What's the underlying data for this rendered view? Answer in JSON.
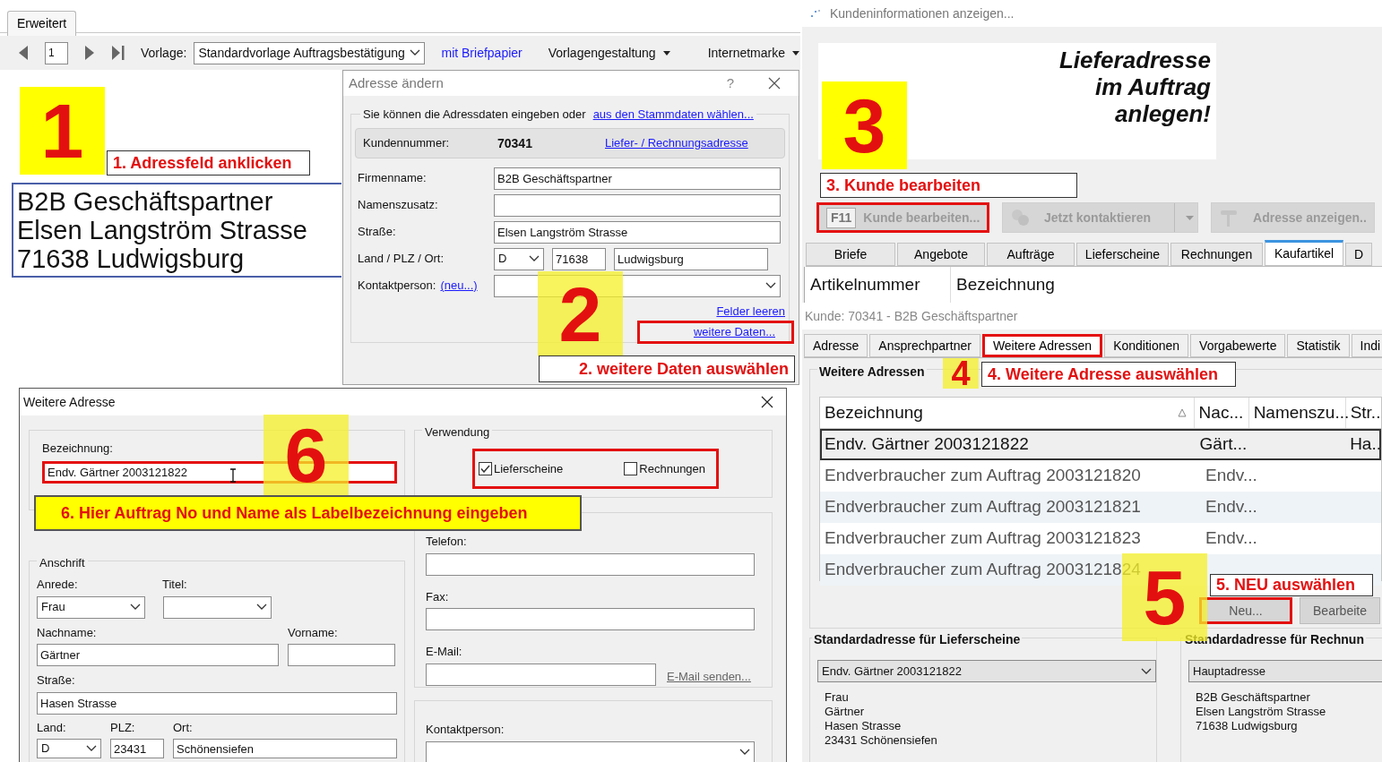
{
  "editor": {
    "tabs": [
      {
        "label": "Erweitert",
        "selected": true
      }
    ],
    "page": "1",
    "template_label": "Vorlage:",
    "template": "Standardvorlage Auftragsbestätigung",
    "letterhead_link": "mit Briefpapier",
    "menus": [
      "Vorlagengestaltung",
      "Internetmarke"
    ],
    "address_lines": [
      "B2B Geschäftspartner",
      "Elsen Langström Strasse",
      "71638 Ludwigsburg"
    ]
  },
  "address_dialog": {
    "title": "Adresse ändern",
    "help": "?",
    "intro": "Sie können die Adressdaten eingeben oder",
    "master_link": "aus den Stammdaten wählen...",
    "customer_label": "Kundennummer:",
    "customer_no": "70341",
    "address_link": "Liefer- / Rechnungsadresse",
    "fields": [
      {
        "label": "Firmenname:",
        "value": "B2B Geschäftspartner"
      },
      {
        "label": "Namenszusatz:"
      },
      {
        "label": "Straße:",
        "value": "Elsen Langström Strasse"
      }
    ],
    "location_label": "Land / PLZ / Ort:",
    "country": "D",
    "zip": "71638",
    "city": "Ludwigsburg",
    "contact_label": "Kontaktperson:",
    "contact_new_link": "(neu...)",
    "clear_link": "Felder leeren",
    "more_link": {
      "label": "weitere Daten...",
      "highlighted": true
    }
  },
  "customer_window": {
    "title": "Kundeninformationen anzeigen...",
    "banner": [
      "Lieferadresse",
      "im Auftrag",
      "anlegen!"
    ],
    "actions": [
      {
        "key": "F11",
        "label": "Kunde bearbeiten...",
        "highlighted": true,
        "disabled": true,
        "kind": "edit"
      },
      {
        "label": "Jetzt kontaktieren",
        "highlighted": false,
        "disabled": true,
        "kind": "contact"
      },
      {
        "label": "Adresse anzeigen..",
        "highlighted": false,
        "disabled": true,
        "kind": "pin"
      }
    ],
    "tabs": [
      {
        "label": "Briefe",
        "selected": false
      },
      {
        "label": "Angebote",
        "selected": false
      },
      {
        "label": "Aufträge",
        "selected": false
      },
      {
        "label": "Lieferscheine",
        "selected": false
      },
      {
        "label": "Rechnungen",
        "selected": false
      },
      {
        "label": "Kaufartikel",
        "selected": true
      },
      {
        "label": "D",
        "selected": false
      }
    ],
    "columns": [
      "Artikelnummer",
      "Bezeichnung"
    ]
  },
  "customer_panel": {
    "title": "Kunde: 70341 - B2B Geschäftspartner",
    "tabs": [
      {
        "label": "Adresse",
        "selected": false,
        "highlighted": false
      },
      {
        "label": "Ansprechpartner",
        "selected": false,
        "highlighted": false
      },
      {
        "label": "Weitere Adressen",
        "selected": true,
        "highlighted": true
      },
      {
        "label": "Konditionen",
        "selected": false,
        "highlighted": false
      },
      {
        "label": "Vorgabewerte",
        "selected": false,
        "highlighted": false
      },
      {
        "label": "Statistik",
        "selected": false,
        "highlighted": false
      },
      {
        "label": "Indi",
        "selected": false,
        "highlighted": false
      }
    ],
    "group_title": "Weitere Adressen",
    "columns": [
      "Bezeichnung",
      "Nac...",
      "Namenszu...",
      "Str.."
    ],
    "rows": [
      {
        "cells": [
          "Endv. Gärtner 2003121822",
          "Gärt...",
          "",
          "Ha.."
        ],
        "selected": true
      },
      {
        "cells": [
          "Endverbraucher zum Auftrag 2003121820",
          "Endv..."
        ],
        "selected": false
      },
      {
        "cells": [
          "Endverbraucher zum Auftrag 2003121821",
          "Endv..."
        ],
        "selected": false
      },
      {
        "cells": [
          "Endverbraucher zum Auftrag 2003121823",
          "Endv..."
        ],
        "selected": false
      },
      {
        "cells": [
          "Endverbraucher zum Auftrag 2003121824"
        ],
        "selected": false
      }
    ],
    "buttons": [
      {
        "label": "Neu...",
        "highlighted": true
      },
      {
        "label": "Bearbeite",
        "highlighted": false
      }
    ],
    "defaults": [
      {
        "title": "Standardadresse für Lieferscheine",
        "select": "Endv. Gärtner 2003121822",
        "lines": [
          "Frau",
          "Gärtner",
          "Hasen Strasse",
          "23431 Schönensiefen"
        ]
      },
      {
        "title": "Standardadresse für Rechnun",
        "select": "Hauptadresse",
        "lines": [
          "B2B Geschäftspartner",
          "Elsen Langström Strasse",
          "71638 Ludwigsburg"
        ]
      }
    ]
  },
  "more_dialog": {
    "title": "Weitere Adresse",
    "name_label": "Bezeichnung:",
    "name_value": "Endv. Gärtner 2003121822",
    "name_highlighted": true,
    "usage_title": "Verwendung",
    "usage_highlighted": true,
    "usage": [
      {
        "label": "Lieferscheine",
        "checked": true
      },
      {
        "label": "Rechnungen",
        "checked": false
      }
    ],
    "address_title": "Anschrift",
    "salutation_label": "Anrede:",
    "salutation": "Frau",
    "title_label": "Titel:",
    "last_name_label": "Nachname:",
    "last_name": "Gärtner",
    "first_name_label": "Vorname:",
    "street_label": "Straße:",
    "street": "Hasen Strasse",
    "country_label": "Land:",
    "zip_label": "PLZ:",
    "city_label": "Ort:",
    "country": "D",
    "zip": "23431",
    "city": "Schönensiefen",
    "phone_label": "Telefon:",
    "fax_label": "Fax:",
    "email_label": "E-Mail:",
    "email_link": "E-Mail senden...",
    "contact_label": "Kontaktperson:"
  },
  "markers": [
    "1",
    "2",
    "3",
    "4",
    "5",
    "6"
  ],
  "callouts": [
    "1. Adressfeld anklicken",
    "2. weitere Daten auswählen",
    "3. Kunde bearbeiten",
    "4. Weitere Adresse auswählen",
    "5. NEU auswählen",
    "6. Hier Auftrag No und Name als Labelbezeichnung eingeben"
  ]
}
